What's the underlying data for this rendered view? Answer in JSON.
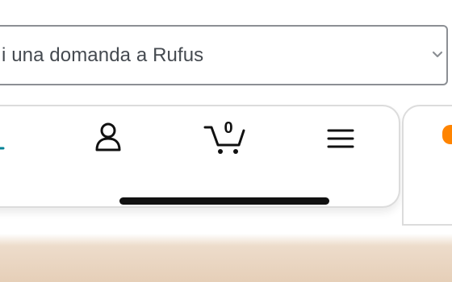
{
  "search": {
    "text": "i una domanda a Rufus"
  },
  "nav": {
    "cart_count": "0",
    "icons": [
      "home-icon",
      "account-icon",
      "cart-icon",
      "menu-icon"
    ]
  },
  "colors": {
    "accent_orange": "#ff8400",
    "accent_teal": "#008296",
    "icon_dark": "#111111"
  }
}
